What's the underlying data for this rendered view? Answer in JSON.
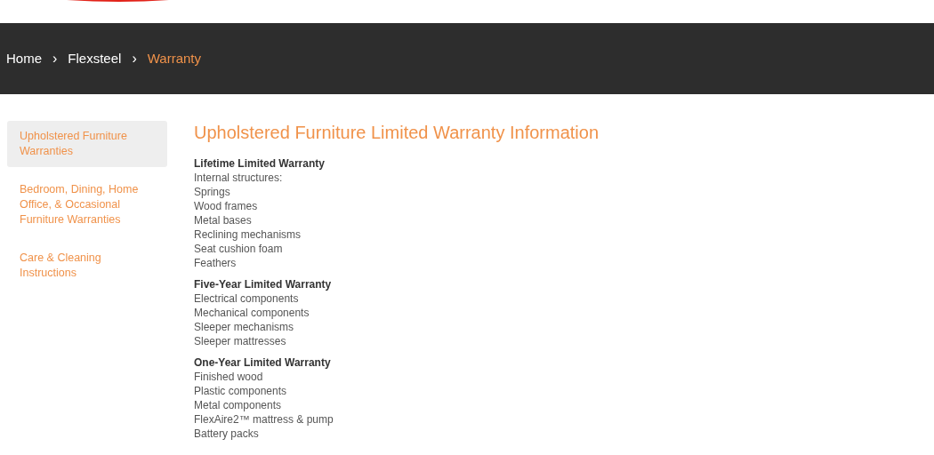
{
  "breadcrumb": [
    {
      "label": "Home",
      "current": false
    },
    {
      "label": "Flexsteel",
      "current": false
    },
    {
      "label": "Warranty",
      "current": true
    }
  ],
  "breadcrumb_separator": "›",
  "sidebar": {
    "items": [
      {
        "label": "Upholstered Furniture Warranties",
        "selected": true
      },
      {
        "label": "Bedroom, Dining, Home Office, & Occasional Furniture Warranties",
        "selected": false
      },
      {
        "label": "Care & Cleaning Instructions",
        "selected": false
      }
    ]
  },
  "heading": "Upholstered Furniture Limited Warranty Information",
  "sections": [
    {
      "title": "Lifetime Limited Warranty",
      "items": [
        "Internal structures:",
        "Springs",
        "Wood frames",
        "Metal bases",
        "Reclining mechanisms",
        "Seat cushion foam",
        "Feathers"
      ]
    },
    {
      "title": "Five-Year Limited Warranty",
      "items": [
        "Electrical components",
        "Mechanical components",
        "Sleeper mechanisms",
        "Sleeper mattresses"
      ]
    },
    {
      "title": "One-Year Limited Warranty",
      "items": [
        "Finished wood",
        "Plastic components",
        "Metal components",
        "FlexAire2™ mattress & pump",
        "Battery packs"
      ]
    }
  ]
}
